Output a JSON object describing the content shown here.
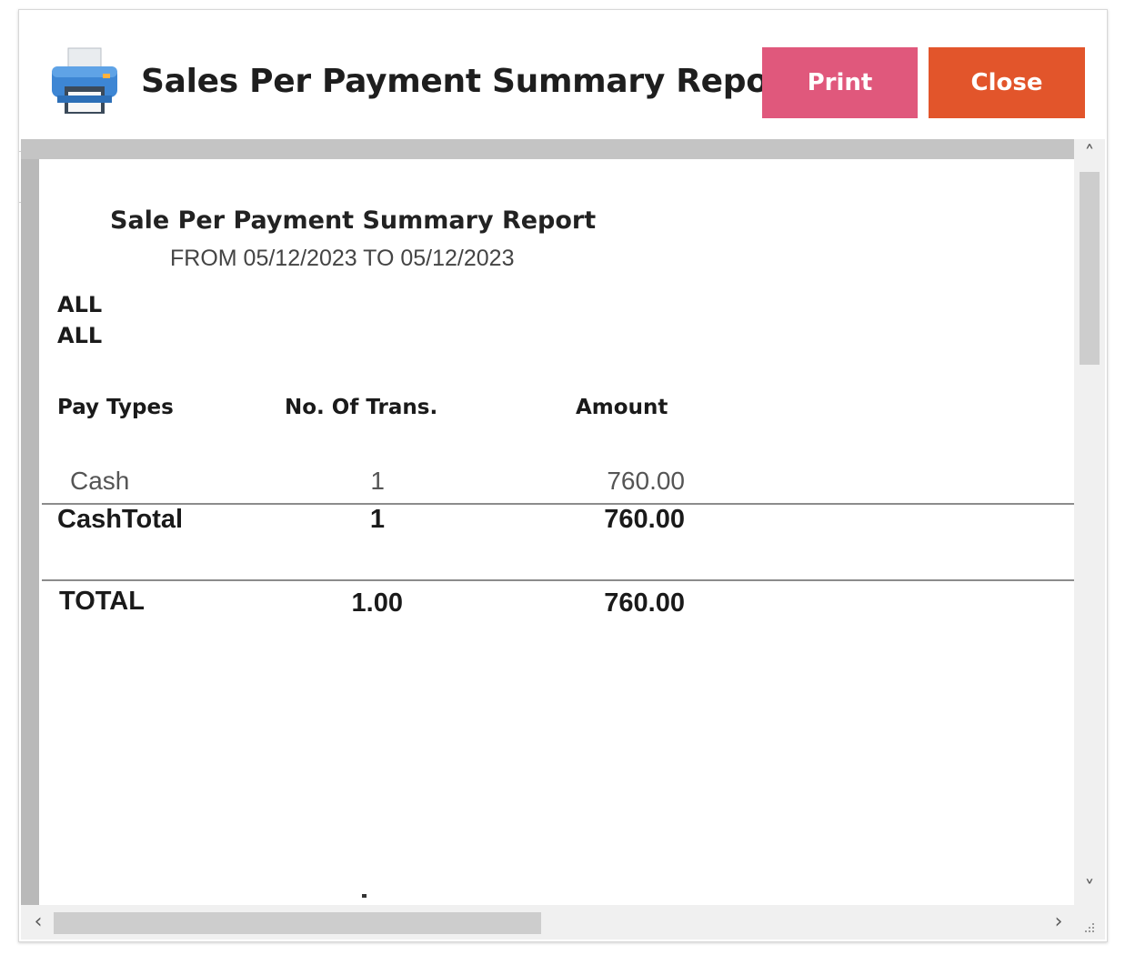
{
  "window": {
    "title": "Sales Per Payment Summary Report"
  },
  "toolbar": {
    "print_label": "Print",
    "close_label": "Close"
  },
  "report": {
    "title": "Sale Per Payment Summary Report",
    "date_range": "FROM 05/12/2023 TO 05/12/2023",
    "filters": [
      "ALL",
      "ALL"
    ],
    "columns": [
      "Pay Types",
      "No. Of Trans.",
      "Amount"
    ],
    "rows": [
      {
        "pay_type": "Cash",
        "transactions": "1",
        "amount": "760.00"
      }
    ],
    "subtotal": {
      "label": "CashTotal",
      "transactions": "1",
      "amount": "760.00"
    },
    "total": {
      "label": "TOTAL",
      "transactions": "1.00",
      "amount": "760.00"
    },
    "footer_mark": "."
  },
  "icons": {
    "header": "printer-icon",
    "scroll_up": "chevron-up-icon",
    "scroll_down": "chevron-down-icon",
    "scroll_left": "chevron-left-icon",
    "scroll_right": "chevron-right-icon",
    "resize": "resize-grip-icon"
  },
  "colors": {
    "print_button": "#e0587c",
    "close_button": "#e2552b",
    "viewer_background": "#b9b9b9",
    "page_background": "#ffffff"
  }
}
